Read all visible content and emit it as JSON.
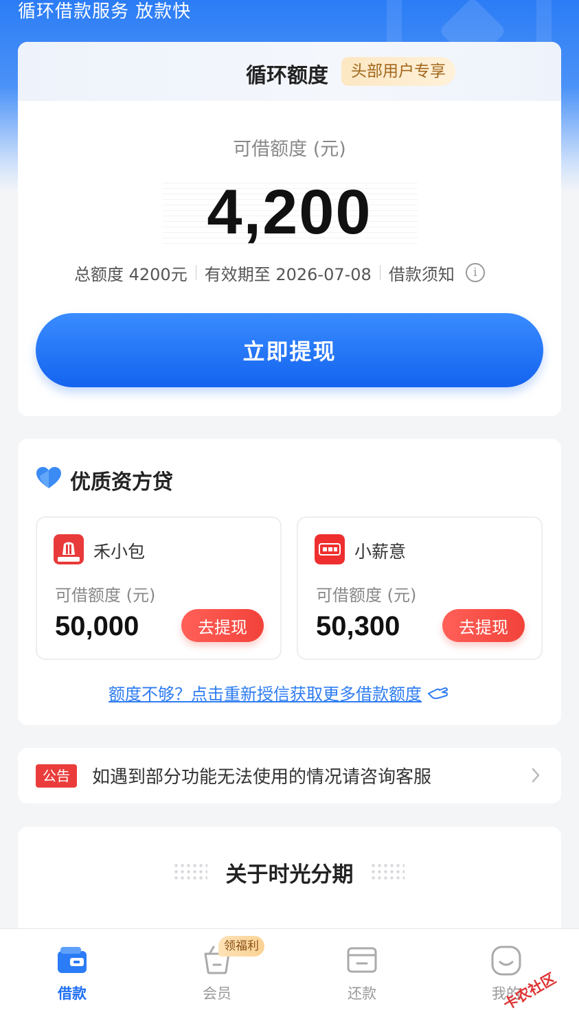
{
  "header": {
    "slogan": "循环借款服务 放款快"
  },
  "credit_card": {
    "title": "循环额度",
    "tag": "头部用户专享",
    "available_label": "可借额度 (元)",
    "available_amount": "4,200",
    "total_limit": "总额度 4200元",
    "valid_until": "有效期至 2026-07-08",
    "notice_link": "借款须知",
    "withdraw_button": "立即提现"
  },
  "lenders": {
    "title": "优质资方贷",
    "items": [
      {
        "name": "禾小包",
        "label": "可借额度 (元)",
        "amount": "50,000",
        "button": "去提现",
        "logo_text": "禾小包",
        "logo_color": "#e83a3a"
      },
      {
        "name": "小薪意",
        "label": "可借额度 (元)",
        "amount": "50,300",
        "button": "去提现",
        "logo_text": "小薪意",
        "logo_color": "#ef2f2f"
      }
    ],
    "reapply_link": "额度不够？点击重新授信获取更多借款额度"
  },
  "notice": {
    "tag": "公告",
    "text": "如遇到部分功能无法使用的情况请咨询客服"
  },
  "about": {
    "title": "关于时光分期"
  },
  "tabbar": {
    "tabs": [
      {
        "label": "借款",
        "icon": "wallet-icon",
        "active": true
      },
      {
        "label": "会员",
        "icon": "basket-icon",
        "active": false
      },
      {
        "label": "还款",
        "icon": "card-icon",
        "active": false
      },
      {
        "label": "我的",
        "icon": "smile-icon",
        "active": false
      }
    ],
    "member_badge": "领福利"
  },
  "watermark": {
    "text": "卡农社区"
  },
  "colors": {
    "primary_blue": "#1f6ff2",
    "accent_red": "#f2423a",
    "vip_gold": "#a0661b"
  }
}
